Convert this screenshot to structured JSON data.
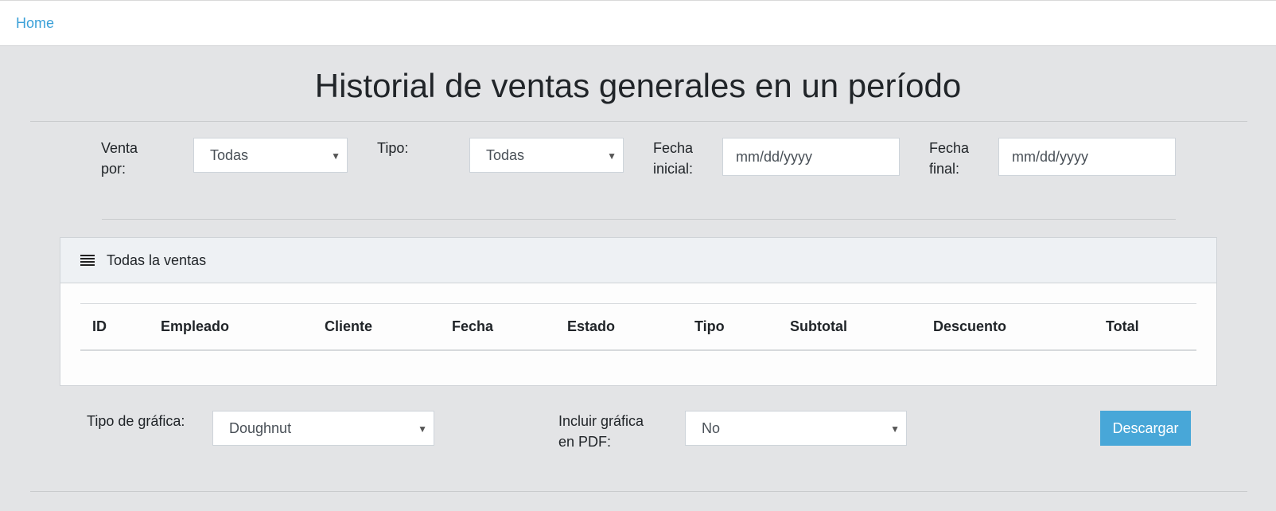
{
  "nav": {
    "home": "Home"
  },
  "page": {
    "title": "Historial de ventas generales en un período"
  },
  "filters": {
    "venta_por_label_1": "Venta",
    "venta_por_label_2": "por:",
    "venta_por_value": "Todas",
    "tipo_label": "Tipo:",
    "tipo_value": "Todas",
    "fecha_inicial_label_1": "Fecha",
    "fecha_inicial_label_2": "inicial:",
    "fecha_inicial_placeholder": "mm/dd/yyyy",
    "fecha_final_label_1": "Fecha",
    "fecha_final_label_2": "final:",
    "fecha_final_placeholder": "mm/dd/yyyy"
  },
  "card": {
    "title": "Todas la ventas",
    "icon": "list-icon",
    "columns": [
      "ID",
      "Empleado",
      "Cliente",
      "Fecha",
      "Estado",
      "Tipo",
      "Subtotal",
      "Descuento",
      "Total"
    ],
    "rows": []
  },
  "footer": {
    "tipo_grafica_label": "Tipo de gráfica:",
    "tipo_grafica_value": "Doughnut",
    "incluir_label_1": "Incluir gráfica",
    "incluir_label_2": "en PDF:",
    "incluir_value": "No",
    "download_label": "Descargar"
  },
  "colors": {
    "accent": "#48a7d8",
    "link": "#3aa0d8",
    "background": "#e3e4e6"
  }
}
